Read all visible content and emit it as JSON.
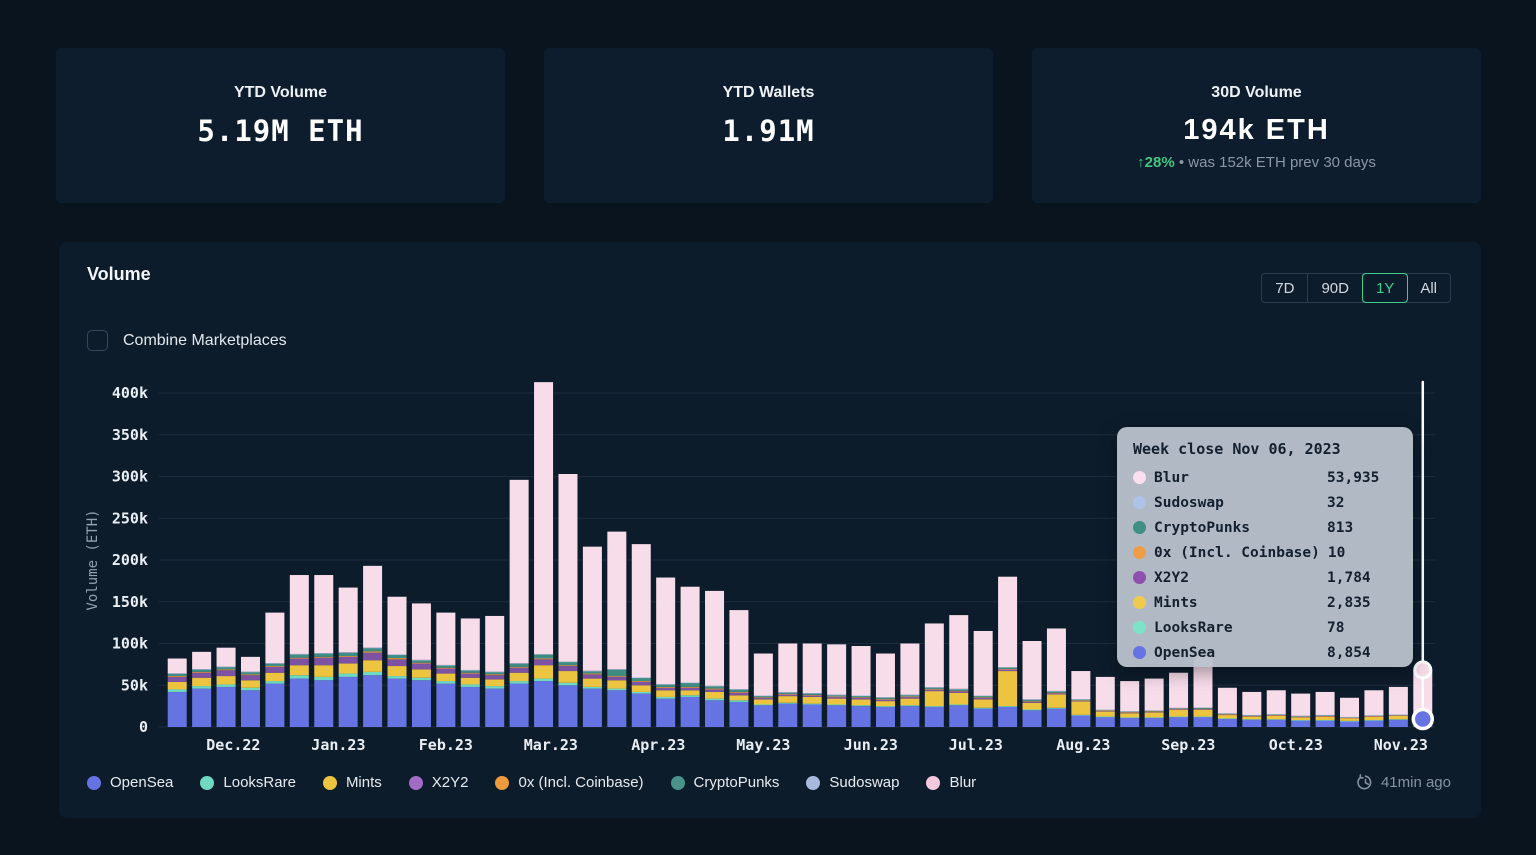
{
  "colors": {
    "page_bg": "#0a141f",
    "card_bg": "#0d1d2d",
    "panel_bg": "#0d1c2b",
    "grid_line": "#1d2c3c",
    "accent_green": "#3ecf8e",
    "delta_green": "#45c581",
    "tooltip_bg": "rgba(187,194,204,0.95)",
    "crosshair_white": "#ffffff"
  },
  "cards": [
    {
      "title": "YTD Volume",
      "value": "5.19M ETH"
    },
    {
      "title": "YTD Wallets",
      "value": "1.91M"
    },
    {
      "title": "30D Volume",
      "value": "194k ETH",
      "delta": "↑28%",
      "delta_note": "• was 152k ETH prev 30 days"
    }
  ],
  "panel": {
    "title": "Volume",
    "timeframes": [
      {
        "label": "7D",
        "active": false
      },
      {
        "label": "90D",
        "active": false
      },
      {
        "label": "1Y",
        "active": true
      },
      {
        "label": "All",
        "active": false
      }
    ],
    "combine_label": "Combine Marketplaces",
    "combine_checked": false,
    "updated": "41min ago"
  },
  "chart_data": {
    "type": "bar",
    "stacked": true,
    "title": "Volume",
    "ylabel": "Volume (ETH)",
    "ylim": [
      0,
      400000
    ],
    "y_unit_of_values": "thousand ETH per week",
    "ytick_labels": [
      "0",
      "50k",
      "100k",
      "150k",
      "200k",
      "250k",
      "300k",
      "350k",
      "400k"
    ],
    "month_labels": [
      "Dec.22",
      "Jan.23",
      "Feb.23",
      "Mar.23",
      "Apr.23",
      "May.23",
      "Jun.23",
      "Jul.23",
      "Aug.23",
      "Sep.23",
      "Oct.23",
      "Nov.23"
    ],
    "month_positions": [
      2.3,
      6.6,
      11.0,
      15.3,
      19.7,
      24.0,
      28.4,
      32.7,
      37.1,
      41.4,
      45.8,
      50.1
    ],
    "series_order": [
      "OpenSea",
      "LooksRare",
      "Mints",
      "X2Y2",
      "0x (Incl. Coinbase)",
      "CryptoPunks",
      "Sudoswap",
      "Blur"
    ],
    "series_colors": [
      "#6673e2",
      "#6fd9c1",
      "#ecc440",
      "#7e52a2",
      "#ed9b3d",
      "#3f8d82",
      "#a9b8dd",
      "#f7dcea"
    ],
    "values": [
      [
        42,
        3,
        9,
        6,
        1,
        3,
        0.3,
        17.7
      ],
      [
        46,
        3,
        10,
        6,
        1,
        3,
        0.3,
        20.7
      ],
      [
        48,
        3,
        10,
        7,
        1,
        3,
        0.3,
        22.7
      ],
      [
        44,
        3,
        9,
        6,
        1,
        3,
        0.3,
        17.7
      ],
      [
        52,
        3,
        10,
        7,
        1,
        3,
        0.4,
        60.6
      ],
      [
        58,
        4,
        12,
        8,
        1,
        4,
        0.5,
        94.5
      ],
      [
        56,
        4,
        14,
        9,
        1,
        4,
        0.5,
        93.5
      ],
      [
        60,
        4,
        12,
        8,
        1,
        4,
        0.5,
        77.5
      ],
      [
        62,
        4,
        14,
        9,
        1.5,
        4,
        0.5,
        98
      ],
      [
        58,
        3,
        12,
        8,
        1.5,
        4,
        0.4,
        69.1
      ],
      [
        56,
        3,
        10,
        7,
        1,
        3,
        0.4,
        67.6
      ],
      [
        52,
        3,
        9,
        6,
        1,
        3,
        0.3,
        62.7
      ],
      [
        48,
        3,
        8,
        5,
        1,
        3,
        0.3,
        61.7
      ],
      [
        46,
        3,
        8,
        5,
        1,
        3,
        0.3,
        66.7
      ],
      [
        52,
        3,
        10,
        6,
        1,
        4,
        0.4,
        219.6
      ],
      [
        55,
        3,
        16,
        7,
        1,
        5,
        0.4,
        325.6
      ],
      [
        50,
        3,
        14,
        6,
        1,
        4,
        0.4,
        224.6
      ],
      [
        46,
        2,
        10,
        5,
        1,
        3,
        0.3,
        148.7
      ],
      [
        44,
        2,
        10,
        4,
        1,
        8,
        0.3,
        164.7
      ],
      [
        40,
        2,
        8,
        4,
        1,
        4,
        0.3,
        159.7
      ],
      [
        34,
        2,
        8,
        3,
        1,
        3,
        0.3,
        127.7
      ],
      [
        36,
        2,
        6,
        3,
        1,
        5,
        0.3,
        114.7
      ],
      [
        32,
        2,
        8,
        3,
        1,
        3,
        0.3,
        113.7
      ],
      [
        30,
        2,
        6,
        3,
        1,
        3,
        0.3,
        94.7
      ],
      [
        26,
        1,
        6,
        2,
        0.5,
        2,
        0.2,
        50.3
      ],
      [
        28,
        1,
        8,
        2,
        0.5,
        2,
        0.2,
        58.3
      ],
      [
        27,
        1,
        8,
        2,
        0.5,
        2,
        0.2,
        59.3
      ],
      [
        26,
        1,
        7,
        2,
        0.5,
        2,
        0.2,
        60.3
      ],
      [
        25,
        1,
        7,
        2,
        0.5,
        2,
        0.2,
        59.3
      ],
      [
        24,
        1,
        6,
        2,
        0.5,
        2,
        0.2,
        52.3
      ],
      [
        25,
        1,
        8,
        2,
        0.5,
        2,
        0.2,
        61.3
      ],
      [
        24,
        1,
        18,
        2,
        0.5,
        2,
        0.2,
        76.3
      ],
      [
        26,
        1,
        14,
        2,
        0.5,
        2,
        0.2,
        88.3
      ],
      [
        22,
        1,
        10,
        2,
        0.5,
        2,
        0.2,
        77.3
      ],
      [
        24,
        1,
        42,
        2,
        0.5,
        2,
        0.2,
        108.3
      ],
      [
        20,
        1,
        8,
        1.5,
        0.5,
        2,
        0.2,
        69.8
      ],
      [
        22,
        1,
        16,
        1.5,
        0.5,
        2,
        0.2,
        74.8
      ],
      [
        14,
        0.5,
        16,
        1,
        0.3,
        1.5,
        0.1,
        33.6
      ],
      [
        12,
        0.5,
        6,
        1,
        0.3,
        1,
        0.1,
        39.1
      ],
      [
        11,
        0.5,
        5,
        1,
        0.3,
        1,
        0.1,
        36.1
      ],
      [
        11,
        0.5,
        6,
        1,
        0.3,
        1,
        0.1,
        38.1
      ],
      [
        12,
        0.5,
        8,
        1,
        0.3,
        1,
        0.1,
        42.1
      ],
      [
        12,
        0.5,
        8,
        1,
        0.3,
        1.5,
        0.1,
        61.6
      ],
      [
        10,
        0.3,
        4,
        0.8,
        0.2,
        1,
        0.1,
        30.6
      ],
      [
        9,
        0.3,
        3,
        0.8,
        0.2,
        1,
        0.1,
        27.6
      ],
      [
        9,
        0.3,
        4,
        0.8,
        0.2,
        1,
        0.1,
        28.6
      ],
      [
        8,
        0.3,
        3,
        0.8,
        0.2,
        1,
        0.1,
        26.6
      ],
      [
        8,
        0.3,
        4,
        0.8,
        0.2,
        1,
        0.1,
        27.6
      ],
      [
        7,
        0.3,
        3,
        0.6,
        0.2,
        0.8,
        0.1,
        23
      ],
      [
        8,
        0.3,
        4,
        0.6,
        0.2,
        0.8,
        0.1,
        30
      ],
      [
        9,
        0.3,
        4,
        0.6,
        0.2,
        0.8,
        0.1,
        33
      ],
      [
        8.854,
        0.078,
        2.835,
        1.784,
        0.01,
        0.813,
        0.032,
        53.935
      ]
    ],
    "crosshair": {
      "bar_index": 51
    }
  },
  "tooltip": {
    "title": "Week close Nov 06, 2023",
    "rows": [
      {
        "name": "Blur",
        "value": "53,935",
        "color": "#fbdeef"
      },
      {
        "name": "Sudoswap",
        "value": "32",
        "color": "#aec3e8"
      },
      {
        "name": "CryptoPunks",
        "value": "813",
        "color": "#3e8f84"
      },
      {
        "name": "0x (Incl. Coinbase)",
        "value": "10",
        "color": "#ef9c49"
      },
      {
        "name": "X2Y2",
        "value": "1,784",
        "color": "#8f4fae"
      },
      {
        "name": "Mints",
        "value": "2,835",
        "color": "#f0ca4d"
      },
      {
        "name": "LooksRare",
        "value": "78",
        "color": "#7ce3c8"
      },
      {
        "name": "OpenSea",
        "value": "8,854",
        "color": "#6673e5"
      }
    ]
  },
  "legend": [
    {
      "name": "OpenSea",
      "color": "#6673e2"
    },
    {
      "name": "LooksRare",
      "color": "#6fd9c1"
    },
    {
      "name": "Mints",
      "color": "#ecc440"
    },
    {
      "name": "X2Y2",
      "color": "#a06cc5"
    },
    {
      "name": "0x (Incl. Coinbase)",
      "color": "#ed9b3d"
    },
    {
      "name": "CryptoPunks",
      "color": "#4a938b"
    },
    {
      "name": "Sudoswap",
      "color": "#a9b8dd"
    },
    {
      "name": "Blur",
      "color": "#f3cadd"
    }
  ]
}
